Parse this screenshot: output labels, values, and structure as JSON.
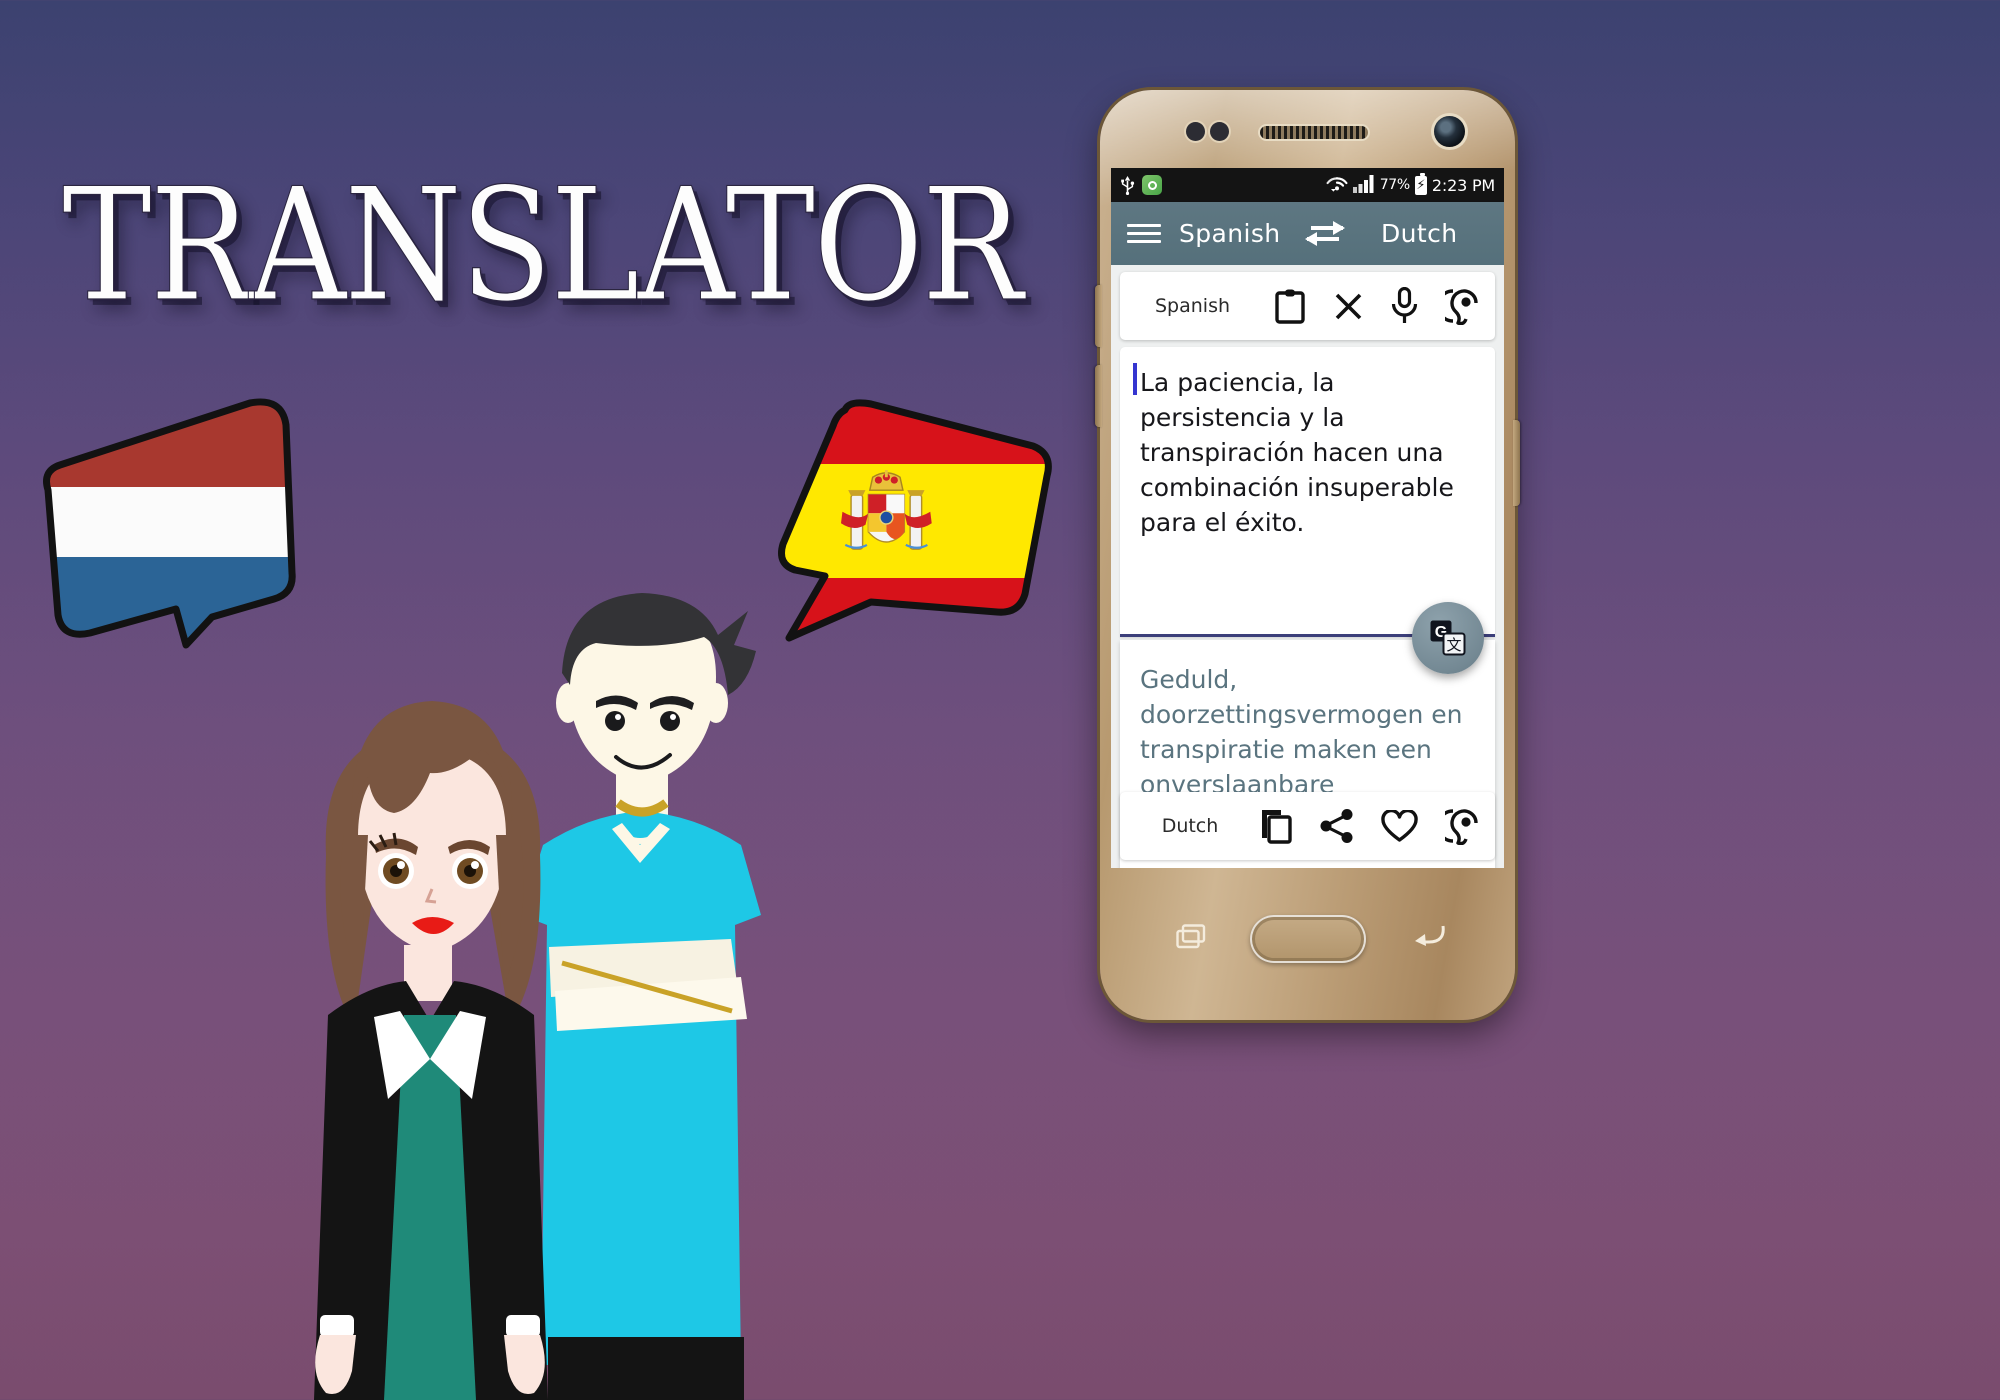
{
  "hero": {
    "title": "TRANSLATOR",
    "bubbles": [
      {
        "name": "dutch-flag-bubble",
        "country": "Netherlands",
        "colors": [
          "#a8382f",
          "#ffffff",
          "#2b6496"
        ],
        "outline": "#111111"
      },
      {
        "name": "spanish-flag-bubble",
        "country": "Spain",
        "colors": [
          "#d7121a",
          "#ffe800",
          "#d7121a"
        ],
        "outline": "#111111"
      }
    ],
    "characters": [
      {
        "name": "female-character",
        "hair": "#7a5641",
        "skin": "#fbe6de",
        "jacket": "#141414",
        "dress": "#1f8a79",
        "lips": "#e81b16"
      },
      {
        "name": "male-character",
        "hair": "#333336",
        "skin": "#fdf7e6",
        "shirt": "#1ec8e6",
        "pants": "#141414",
        "necklace": "#c9a227"
      }
    ],
    "background_gradient": [
      "#3c4270",
      "#6e4f7d",
      "#7a4c6e"
    ]
  },
  "phone": {
    "body_color": "#bd9e76",
    "hardware": {
      "recent_apps_label": "recent-apps",
      "home_label": "home",
      "back_label": "back"
    },
    "status_bar": {
      "icons_left": [
        "usb-icon",
        "app-notification-icon"
      ],
      "wifi": "wifi-icon",
      "signal": "signal-bars-icon",
      "battery_percent": "77%",
      "battery_state": "charging",
      "time": "2:23 PM"
    },
    "app_bar": {
      "menu_icon": "hamburger-menu-icon",
      "source_language": "Spanish",
      "swap_icon": "swap-arrows-icon",
      "target_language": "Dutch",
      "bar_color": "#576f7a"
    },
    "source_panel": {
      "language_label": "Spanish",
      "actions": [
        {
          "name": "paste-clipboard-button",
          "icon": "clipboard-icon"
        },
        {
          "name": "clear-text-button",
          "icon": "close-x-icon"
        },
        {
          "name": "voice-input-button",
          "icon": "microphone-icon"
        },
        {
          "name": "listen-source-button",
          "icon": "ear-listen-icon"
        }
      ],
      "text": "La paciencia, la persistencia y la transpiración hacen una combinación insuperable para el éxito.",
      "caret_visible": true,
      "underline_color": "#3c3f7a"
    },
    "translate_fab": {
      "name": "translate-fab",
      "icon": "google-translate-icon",
      "color": "#74898f"
    },
    "target_panel": {
      "text": "Geduld, doorzettingsvermogen en transpiratie maken een onverslaanbare combinatie voor succes.",
      "text_color": "#5a747f",
      "language_label": "Dutch",
      "actions": [
        {
          "name": "copy-translation-button",
          "icon": "copy-icon"
        },
        {
          "name": "share-translation-button",
          "icon": "share-icon"
        },
        {
          "name": "favorite-translation-button",
          "icon": "heart-icon"
        },
        {
          "name": "listen-translation-button",
          "icon": "ear-listen-icon"
        }
      ]
    }
  }
}
